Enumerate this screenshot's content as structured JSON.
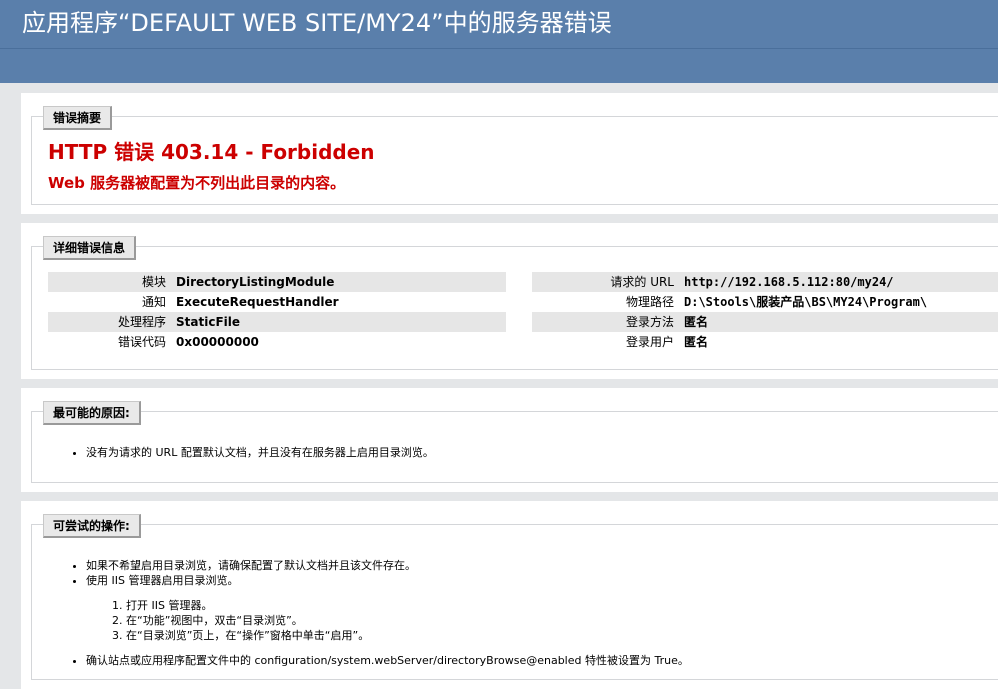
{
  "window": {
    "title": "应用程序“DEFAULT WEB SITE/MY24”中的服务器错误"
  },
  "summary": {
    "tab": "错误摘要",
    "error_title": "HTTP 错误  403.14 - Forbidden",
    "error_message": "Web 服务器被配置为不列出此目录的内容。"
  },
  "details": {
    "tab": "详细错误信息",
    "left": [
      {
        "label": "模块",
        "value": "DirectoryListingModule"
      },
      {
        "label": "通知",
        "value": "ExecuteRequestHandler"
      },
      {
        "label": "处理程序",
        "value": "StaticFile"
      },
      {
        "label": "错误代码",
        "value": "0x00000000"
      }
    ],
    "right": [
      {
        "label": "请求的 URL",
        "value": "http://192.168.5.112:80/my24/"
      },
      {
        "label": "物理路径",
        "value": "D:\\Stools\\服装产品\\BS\\MY24\\Program\\"
      },
      {
        "label": "登录方法",
        "value": "匿名"
      },
      {
        "label": "登录用户",
        "value": "匿名"
      }
    ]
  },
  "causes": {
    "tab": "最可能的原因:",
    "items": [
      "没有为请求的 URL 配置默认文档，并且没有在服务器上启用目录浏览。"
    ]
  },
  "actions": {
    "tab": "可尝试的操作:",
    "items": [
      "如果不希望启用目录浏览，请确保配置了默认文档并且该文件存在。",
      "使用  IIS 管理器启用目录浏览。"
    ],
    "steps": [
      "打开  IIS 管理器。",
      "在“功能”视图中，双击“目录浏览”。",
      "在“目录浏览”页上，在“操作”窗格中单击“启用”。"
    ],
    "final_item": "确认站点或应用程序配置文件中的  configuration/system.webServer/directoryBrowse@enabled 特性被设置为  True。"
  }
}
